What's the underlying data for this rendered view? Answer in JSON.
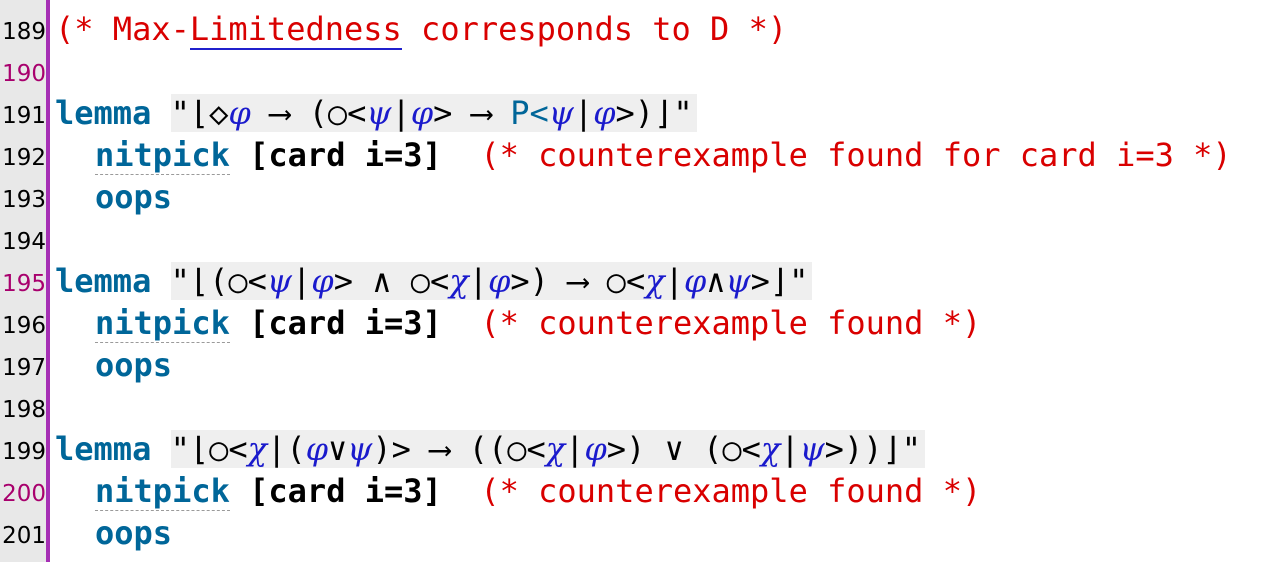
{
  "colors": {
    "comment": "#d90000",
    "keyword": "#006699",
    "greek": "#1a1acc",
    "gutter_bar": "#a62fb5",
    "modified_line_number": "#a8006d"
  },
  "lines": [
    {
      "num": "189",
      "comment_pre": "(* Max-",
      "comment_ul": "Limitedness",
      "comment_post": " corresponds to D *)"
    },
    {
      "num": "190"
    },
    {
      "num": "191",
      "kw": "lemma",
      "quote_open": "\"⌊◇",
      "phi1": "φ",
      "p1": " ⟶ (○<",
      "psi1": "ψ",
      "bar1": "|",
      "phi2": "φ",
      "p2": "> ⟶ ",
      "P": "P<",
      "psi2": "ψ",
      "bar2": "|",
      "phi3": "φ",
      "p3": ">)⌋\""
    },
    {
      "num": "192",
      "kw": "nitpick",
      "args": "[card i=3]",
      "comment": "(* counterexample found for card i=3 *)"
    },
    {
      "num": "193",
      "kw": "oops"
    },
    {
      "num": "194"
    },
    {
      "num": "195",
      "kw": "lemma",
      "t1": "\"⌊(○<",
      "psi1": "ψ",
      "t2": "|",
      "phi1": "φ",
      "t3": "> ∧ ○<",
      "chi1": "χ",
      "t4": "|",
      "phi2": "φ",
      "t5": ">) ⟶ ○<",
      "chi2": "χ",
      "t6": "|",
      "phi3": "φ",
      "t7": "∧",
      "psi2": "ψ",
      "t8": ">⌋\""
    },
    {
      "num": "196",
      "kw": "nitpick",
      "args": "[card i=3]",
      "comment": "(* counterexample found *)"
    },
    {
      "num": "197",
      "kw": "oops"
    },
    {
      "num": "198"
    },
    {
      "num": "199",
      "kw": "lemma",
      "t1": "\"⌊○<",
      "chi1": "χ",
      "t2": "|(",
      "phi1": "φ",
      "t3": "∨",
      "psi1": "ψ",
      "t4": ")> ⟶ ((○<",
      "chi2": "χ",
      "t5": "|",
      "phi2": "φ",
      "t6": ">) ∨ (○<",
      "chi3": "χ",
      "t7": "|",
      "psi2": "ψ",
      "t8": ">))⌋\""
    },
    {
      "num": "200",
      "kw": "nitpick",
      "args": "[card i=3]",
      "comment": "(* counterexample found *)"
    },
    {
      "num": "201",
      "kw": "oops"
    }
  ]
}
